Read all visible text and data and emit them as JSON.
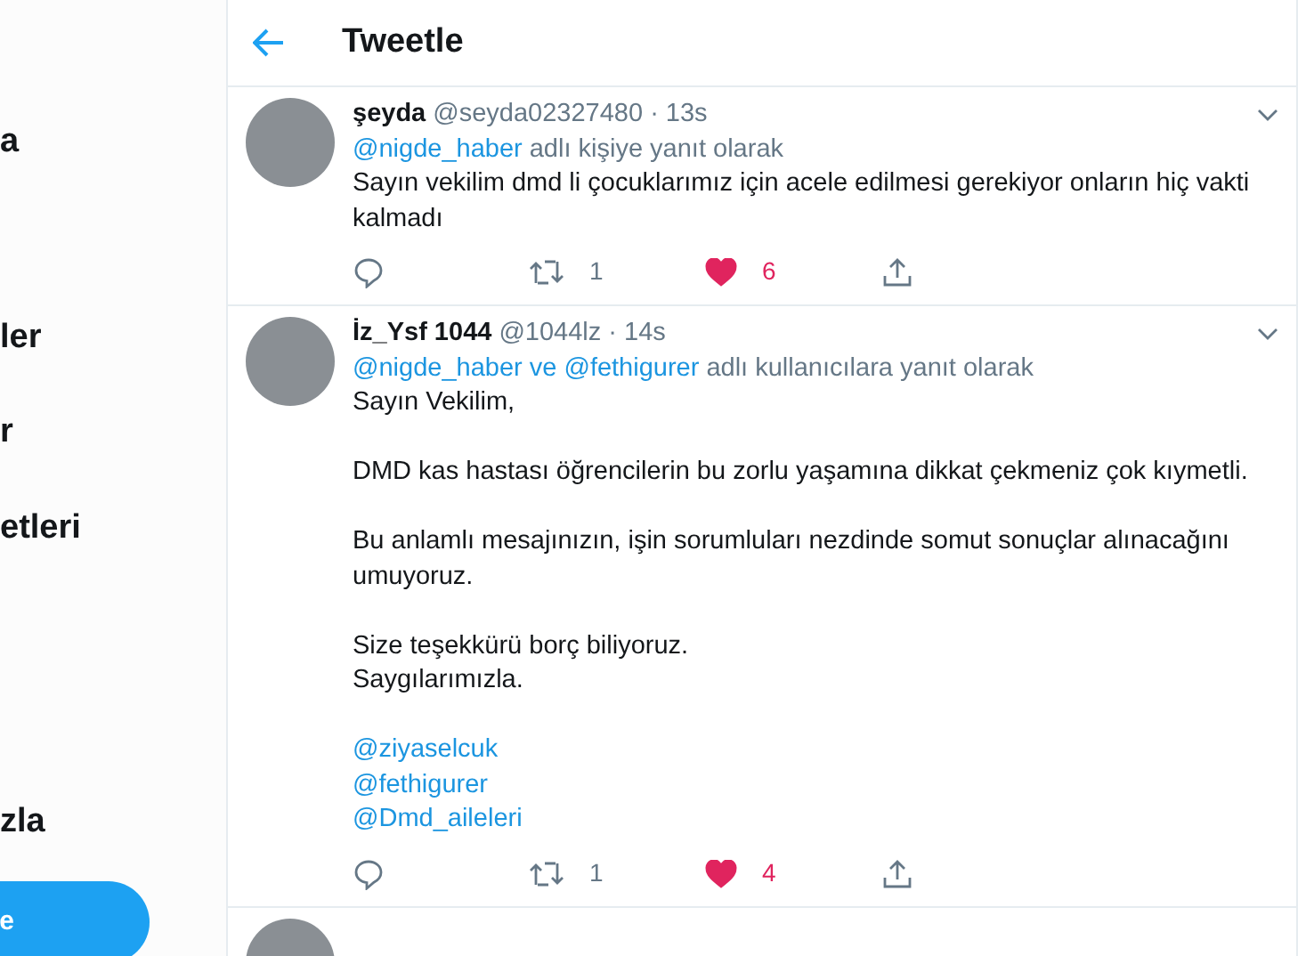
{
  "sidebar": {
    "items": [
      {
        "label": "a"
      },
      {
        "label": "ler"
      },
      {
        "label": "r"
      },
      {
        "label": "etleri"
      },
      {
        "label": "zla"
      }
    ],
    "button": "e"
  },
  "header": {
    "title": "Tweetle"
  },
  "tweets": [
    {
      "name": "şeyda",
      "handle": "@seyda02327480",
      "separator": "·",
      "time": "13s",
      "reply_mentions": "@nigde_haber",
      "reply_text": "adlı kişiye yanıt olarak",
      "paragraphs": [
        "Sayın vekilim dmd li çocuklarımız için acele edilmesi gerekiyor onların hiç vakti kalmadı"
      ],
      "retweets": "1",
      "likes": "6",
      "liked": true
    },
    {
      "name": "İz_Ysf 1044",
      "handle": "@1044lz",
      "separator": "·",
      "time": "14s",
      "reply_mentions": "@nigde_haber ve @fethigurer",
      "reply_text": "adlı kullanıcılara yanıt olarak",
      "paragraphs": [
        "Sayın Vekilim,",
        "DMD kas hastası öğrencilerin bu zorlu yaşamına dikkat çekmeniz çok kıymetli.",
        "Bu anlamlı mesajınızın, işin sorumluları nezdinde somut sonuçlar alınacağını umuyoruz.",
        "Size teşekkürü borç biliyoruz.\nSaygılarımızla."
      ],
      "mentions": [
        "@ziyaselcuk",
        "@fethigurer",
        "@Dmd_aileleri"
      ],
      "retweets": "1",
      "likes": "4",
      "liked": true
    }
  ]
}
